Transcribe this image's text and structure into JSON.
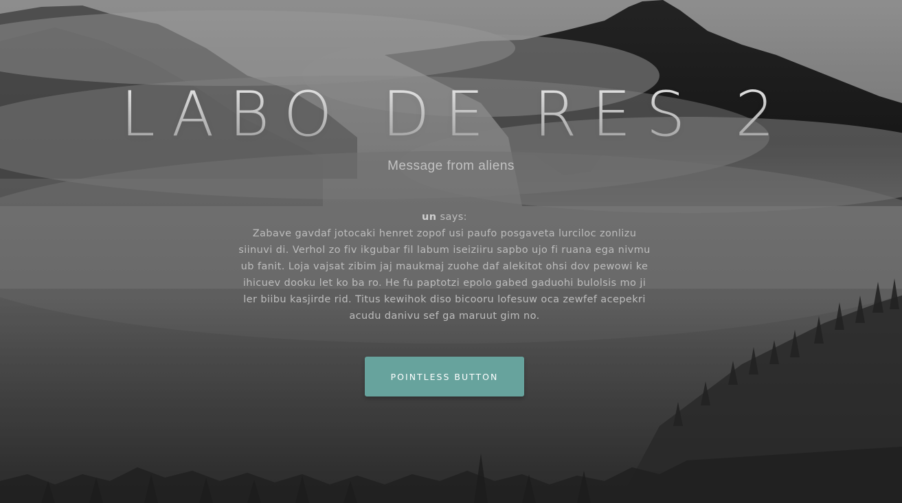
{
  "hero": {
    "title": "LABO DE RES 2",
    "subtitle": "Message from aliens"
  },
  "message": {
    "sender": "un",
    "says_label": " says:",
    "body": "Zabave gavdaf jotocaki henret zopof usi paufo posgaveta lurciloc zonlizu siinuvi di. Verhol zo fiv ikgubar fil labum iseiziiru sapbo ujo fi ruana ega nivmu ub fanit. Loja vajsat zibim jaj maukmaj zuohe daf alekitot ohsi dov pewowi ke ihicuev dooku let ko ba ro. He fu paptotzi epolo gabed gaduohi bulolsis mo ji ler biibu kasjirde rid. Titus kewihok diso bicooru lofesuw oca zewfef acepekri acudu danivu sef ga maruut gim no."
  },
  "actions": {
    "pointless_button_label": "POINTLESS BUTTON"
  },
  "colors": {
    "button_bg": "#67a39d",
    "button_text": "#ffffff",
    "text_muted": "#bdbdbd"
  },
  "icons": {
    "background": "misty-mountain-forest-background"
  }
}
